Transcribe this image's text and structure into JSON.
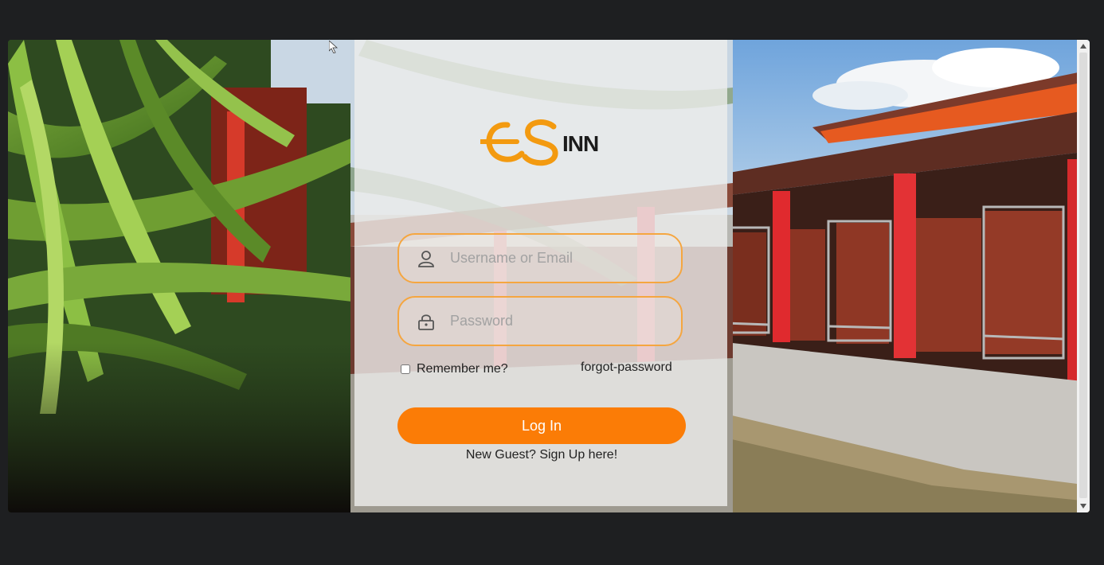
{
  "brand": {
    "logo_text": "INN",
    "logo_mark": "ES",
    "accent_color": "#fb7c06",
    "field_border_color": "#f5a640"
  },
  "login_form": {
    "username_placeholder": "Username or Email",
    "password_placeholder": "Password",
    "remember_label": "Remember me?",
    "remember_checked": false,
    "forgot_label": "forgot-password",
    "submit_label": "Log In",
    "signup_label": "New Guest? Sign Up here!"
  },
  "icons": {
    "username": "user-icon",
    "password": "lock-icon",
    "scroll_up": "chevron-up-icon",
    "scroll_down": "chevron-down-icon"
  }
}
